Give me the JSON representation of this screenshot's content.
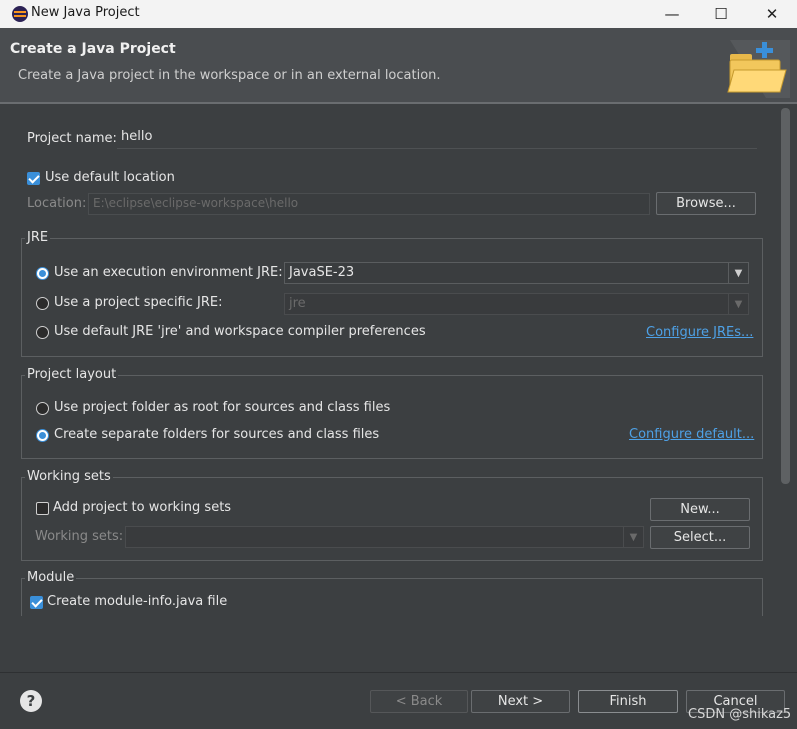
{
  "window": {
    "title": "New Java Project",
    "controls": {
      "minimize": "—",
      "maximize": "☐",
      "close": "✕"
    }
  },
  "header": {
    "title": "Create a Java Project",
    "description": "Create a Java project in the workspace or in an external location.",
    "icon": "new-project-folder-icon"
  },
  "project": {
    "name_label": "Project name:",
    "name_value": "hello"
  },
  "location": {
    "use_default_label": "Use default location",
    "use_default_checked": true,
    "location_label": "Location:",
    "location_value": "E:\\eclipse\\eclipse-workspace\\hello",
    "browse_label": "Browse..."
  },
  "jre": {
    "group_title": "JRE",
    "option_execution_env": "Use an execution environment JRE:",
    "execution_env_value": "JavaSE-23",
    "option_project_specific": "Use a project specific JRE:",
    "project_specific_value": "jre",
    "option_default": "Use default JRE 'jre' and workspace compiler preferences",
    "configure_link": "Configure JREs...",
    "selected": "execution_env"
  },
  "layout": {
    "group_title": "Project layout",
    "option_root": "Use project folder as root for sources and class files",
    "option_separate": "Create separate folders for sources and class files",
    "configure_link": "Configure default...",
    "selected": "separate"
  },
  "working_sets": {
    "group_title": "Working sets",
    "add_label": "Add project to working sets",
    "add_checked": false,
    "new_label": "New...",
    "sets_label": "Working sets:",
    "select_label": "Select..."
  },
  "module": {
    "group_title": "Module",
    "create_label": "Create module-info.java file",
    "create_checked": true
  },
  "footer": {
    "back_label": "< Back",
    "next_label": "Next >",
    "finish_label": "Finish",
    "cancel_label": "Cancel",
    "help_icon": "?",
    "watermark": "CSDN @shikaz5"
  }
}
